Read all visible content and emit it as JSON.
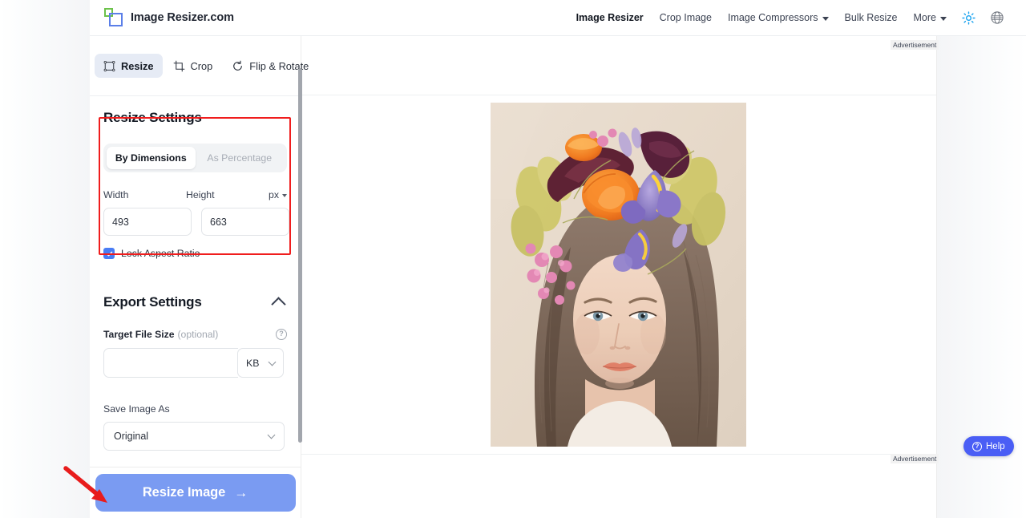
{
  "brand": {
    "name": "Image Resizer.com",
    "logo_icon": "resize-logo-icon"
  },
  "nav": {
    "items": [
      {
        "label": "Image Resizer",
        "active": true,
        "has_caret": false
      },
      {
        "label": "Crop Image",
        "active": false,
        "has_caret": false
      },
      {
        "label": "Image Compressors",
        "active": false,
        "has_caret": true
      },
      {
        "label": "Bulk Resize",
        "active": false,
        "has_caret": false
      },
      {
        "label": "More",
        "active": false,
        "has_caret": true
      }
    ],
    "theme_toggle_icon": "sun-icon",
    "language_icon": "globe-icon",
    "theme_accent": "#1aa3f0"
  },
  "tabs": [
    {
      "label": "Resize",
      "icon": "resize-frame-icon",
      "active": true
    },
    {
      "label": "Crop",
      "icon": "crop-icon",
      "active": false
    },
    {
      "label": "Flip & Rotate",
      "icon": "rotate-icon",
      "active": false
    }
  ],
  "resize_settings": {
    "title": "Resize Settings",
    "mode_tabs": [
      {
        "label": "By Dimensions",
        "active": true
      },
      {
        "label": "As Percentage",
        "active": false
      }
    ],
    "width_label": "Width",
    "height_label": "Height",
    "width_value": "493",
    "height_value": "663",
    "unit": "px",
    "lock_aspect_label": "Lock Aspect Ratio",
    "lock_aspect_checked": true,
    "highlight_color": "#f01d1d"
  },
  "export_settings": {
    "title": "Export Settings",
    "collapse_icon": "chevron-up-icon",
    "target_file_size_label": "Target File Size",
    "target_file_size_optional": "(optional)",
    "help_icon": "question-circle-icon",
    "target_file_size_value": "",
    "target_file_size_placeholder": "",
    "size_unit": "KB",
    "save_image_as_label": "Save Image As",
    "save_image_as_value": "Original"
  },
  "action": {
    "resize_button_label": "Resize Image",
    "resize_button_arrow": "→",
    "button_color": "#7a9bf2",
    "annotation_arrow_color": "#e81c1c"
  },
  "ads": {
    "top_label": "Advertisement",
    "bottom_label": "Advertisement"
  },
  "help": {
    "label": "Help",
    "icon": "question-circle-icon",
    "color": "#4a5ef5"
  },
  "canvas": {
    "image_alt": "Portrait of a woman wearing a floral crown with orange tulips, purple irises and pink blossoms",
    "background": "#e8d9c9"
  }
}
